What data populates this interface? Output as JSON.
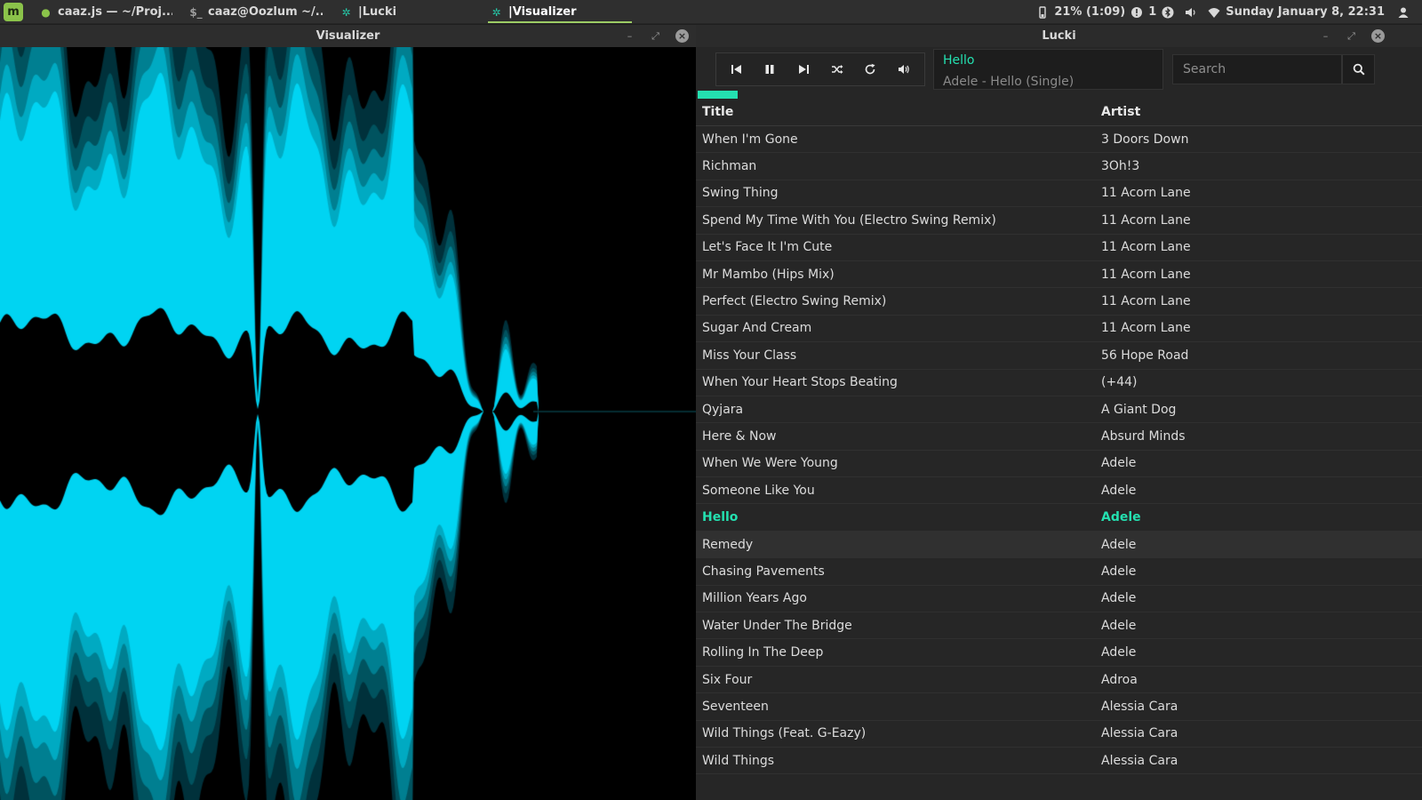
{
  "panel": {
    "menu_icon_label": "m",
    "tabs": [
      {
        "label": "caaz.js — ~/Proj...",
        "icon_glyph": "●",
        "icon_color": "#8bc34a",
        "active": false
      },
      {
        "label": "caaz@Oozlum ~/...",
        "icon_glyph": "$_",
        "icon_color": "#9e9e9e",
        "active": false
      },
      {
        "label": "|Lucki",
        "icon_glyph": "✲",
        "icon_color": "#26c6a6",
        "active": false
      },
      {
        "label": "|Visualizer",
        "icon_glyph": "✲",
        "icon_color": "#26c6a6",
        "active": true
      }
    ],
    "battery_text": "21% (1:09)",
    "notification_count": "1",
    "clock": "Sunday January  8, 22:31"
  },
  "visualizer": {
    "window_title": "Visualizer",
    "accent": "#00d4f2"
  },
  "lucki": {
    "window_title": "Lucki",
    "controls": [
      "previous-icon",
      "pause-icon",
      "next-icon",
      "shuffle-icon",
      "repeat-icon",
      "volume-icon"
    ],
    "now_playing": {
      "title": "Hello",
      "subtitle": "Adele - Hello (Single)"
    },
    "search_placeholder": "Search",
    "progress": 0.055,
    "accent": "#24e0b0",
    "columns": {
      "title": "Title",
      "artist": "Artist"
    },
    "tracks": [
      {
        "title": "When I'm Gone",
        "artist": "3 Doors Down"
      },
      {
        "title": "Richman",
        "artist": "3Oh!3"
      },
      {
        "title": "Swing Thing",
        "artist": "11 Acorn Lane"
      },
      {
        "title": "Spend My Time With You (Electro Swing Remix)",
        "artist": "11 Acorn Lane"
      },
      {
        "title": "Let's Face It I'm Cute",
        "artist": "11 Acorn Lane"
      },
      {
        "title": "Mr Mambo (Hips Mix)",
        "artist": "11 Acorn Lane"
      },
      {
        "title": "Perfect (Electro Swing Remix)",
        "artist": "11 Acorn Lane"
      },
      {
        "title": "Sugar And Cream",
        "artist": "11 Acorn Lane"
      },
      {
        "title": "Miss Your Class",
        "artist": "56 Hope Road"
      },
      {
        "title": "When Your Heart Stops Beating",
        "artist": "(+44)"
      },
      {
        "title": "Qyjara",
        "artist": "A Giant Dog"
      },
      {
        "title": "Here & Now",
        "artist": "Absurd Minds"
      },
      {
        "title": "When We Were Young",
        "artist": "Adele"
      },
      {
        "title": "Someone Like You",
        "artist": "Adele"
      },
      {
        "title": "Hello",
        "artist": "Adele",
        "playing": true
      },
      {
        "title": "Remedy",
        "artist": "Adele",
        "hovered": true
      },
      {
        "title": "Chasing Pavements",
        "artist": "Adele"
      },
      {
        "title": "Million Years Ago",
        "artist": "Adele"
      },
      {
        "title": "Water Under The Bridge",
        "artist": "Adele"
      },
      {
        "title": "Rolling In The Deep",
        "artist": "Adele"
      },
      {
        "title": "Six Four",
        "artist": "Adroa"
      },
      {
        "title": "Seventeen",
        "artist": "Alessia Cara"
      },
      {
        "title": "Wild Things (Feat. G-Eazy)",
        "artist": "Alessia Cara"
      },
      {
        "title": "Wild Things",
        "artist": "Alessia Cara"
      }
    ]
  }
}
